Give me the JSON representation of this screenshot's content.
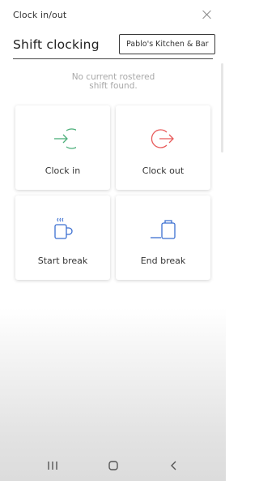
{
  "window": {
    "title": "Clock in/out"
  },
  "header": {
    "title": "Shift clocking",
    "venue_selector": "Pablo's Kitchen & Bar"
  },
  "notice": {
    "line1": "No current rostered",
    "line2": "shift found."
  },
  "actions": [
    {
      "label": "Clock in",
      "icon": "arrow-in-circle-icon",
      "color": "#4caf7a"
    },
    {
      "label": "Clock out",
      "icon": "arrow-out-circle-icon",
      "color": "#e85a5a"
    },
    {
      "label": "Start break",
      "icon": "coffee-mug-icon",
      "color": "#3b6fd1"
    },
    {
      "label": "End break",
      "icon": "flask-icon",
      "color": "#3b6fd1"
    }
  ],
  "navbar": {
    "items": [
      "recents-icon",
      "home-icon",
      "back-icon"
    ]
  }
}
